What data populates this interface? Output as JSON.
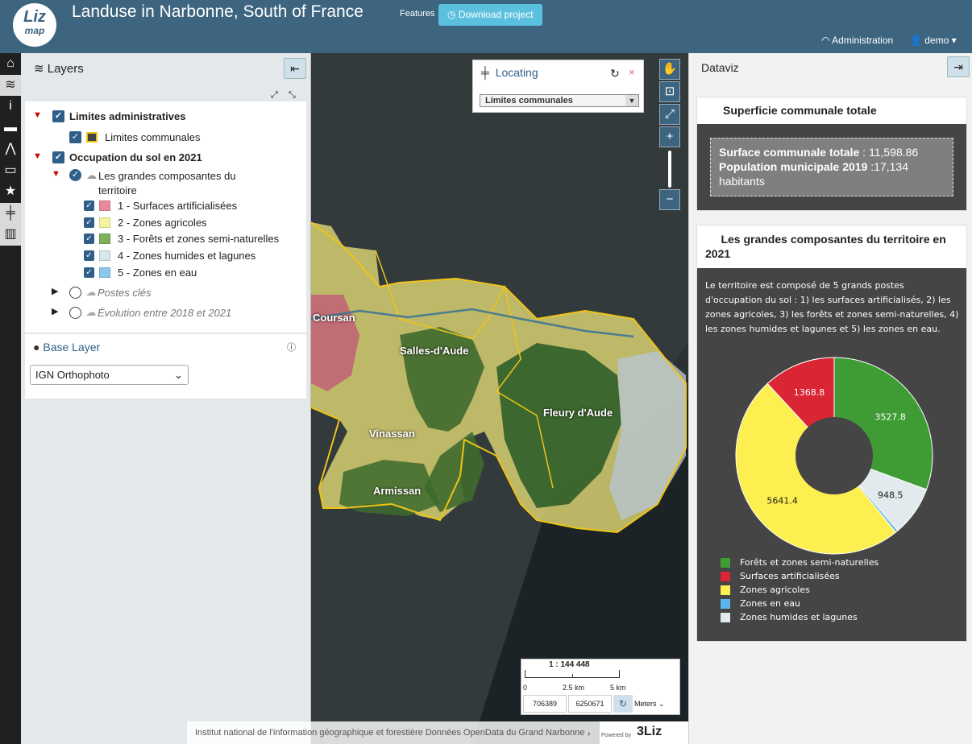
{
  "header": {
    "logo_top": "Liz",
    "logo_bottom": "map",
    "title": "Landuse in Narbonne, South of France",
    "features_label": "Features",
    "download_label": "Download project",
    "admin_label": "Administration",
    "user_label": "demo"
  },
  "layers_panel": {
    "title": "Layers",
    "groups": [
      {
        "label": "Limites administratives",
        "children": [
          {
            "label": "Limites communales",
            "color": "#f0c419"
          }
        ]
      },
      {
        "label": "Occupation du sol en 2021",
        "sub_group": "Les grandes composantes du territoire",
        "classes": [
          {
            "label": "1 - Surfaces artificialisées",
            "color": "#e78a9f"
          },
          {
            "label": "2 - Zones agricoles",
            "color": "#f6f2a0"
          },
          {
            "label": "3 - Forêts et zones semi-naturelles",
            "color": "#7fb05c"
          },
          {
            "label": "4 - Zones humides et lagunes",
            "color": "#d8e6ee"
          },
          {
            "label": "5 - Zones en eau",
            "color": "#8cc8ec"
          }
        ]
      }
    ],
    "other_groups": [
      "Postes clés",
      "Évolution entre 2018 et 2021"
    ]
  },
  "base_layer": {
    "title": "Base Layer",
    "selected": "IGN Orthophoto"
  },
  "locating": {
    "title": "Locating",
    "selected": "Limites communales"
  },
  "map": {
    "towns": [
      "Coursan",
      "Salles-d'Aude",
      "Fleury d'Aude",
      "Vinassan",
      "Armissan"
    ],
    "scale_label": "1 : 144 448",
    "scale_ticks": [
      "0",
      "2.5 km",
      "5 km"
    ],
    "coord_x": "706389",
    "coord_y": "6250671",
    "units": "Meters",
    "attribution": "Institut national de l'information géographique et forestière Données OpenData du Grand Narbonne",
    "powered_by": "Powered by",
    "powered_brand": "3Liz"
  },
  "dataviz": {
    "title": "Dataviz",
    "card1": {
      "title": "Superficie communale totale",
      "surface_label": "Surface communale totale",
      "surface_value": " : 11,598.86",
      "pop_label": "Population municipale 2019",
      "pop_value": " :17,134",
      "pop_unit": "habitants"
    },
    "card2": {
      "title": "Les grandes composantes du territoire en 2021",
      "description": "Le territoire est composé de 5 grands postes d'occupation du sol : 1) les surfaces artificialisés, 2) les zones agricoles, 3) les forêts et zones semi-naturelles, 4) les zones humides et lagunes et 5) les zones en eau."
    }
  },
  "chart_data": {
    "type": "pie",
    "hole": true,
    "title": "Les grandes composantes du territoire en 2021",
    "series": [
      {
        "label": "Forêts et zones semi-naturelles",
        "value": 3527.8,
        "color": "#3f9c35"
      },
      {
        "label": "Zones humides et lagunes",
        "value": 948.5,
        "color": "#e2eaee"
      },
      {
        "label": "Zones en eau",
        "value": 50,
        "color": "#5bb5e8"
      },
      {
        "label": "Zones agricoles",
        "value": 5641.4,
        "color": "#fcef4f"
      },
      {
        "label": "Surfaces artificialisées",
        "value": 1368.8,
        "color": "#d92534"
      }
    ],
    "legend_order": [
      "Forêts et zones semi-naturelles",
      "Surfaces artificialisées",
      "Zones agricoles",
      "Zones en eau",
      "Zones humides et lagunes"
    ],
    "legend_placement": "bottom",
    "shown_value_labels": [
      "3527.8",
      "948.5",
      "5641.4",
      "1368.8"
    ]
  }
}
